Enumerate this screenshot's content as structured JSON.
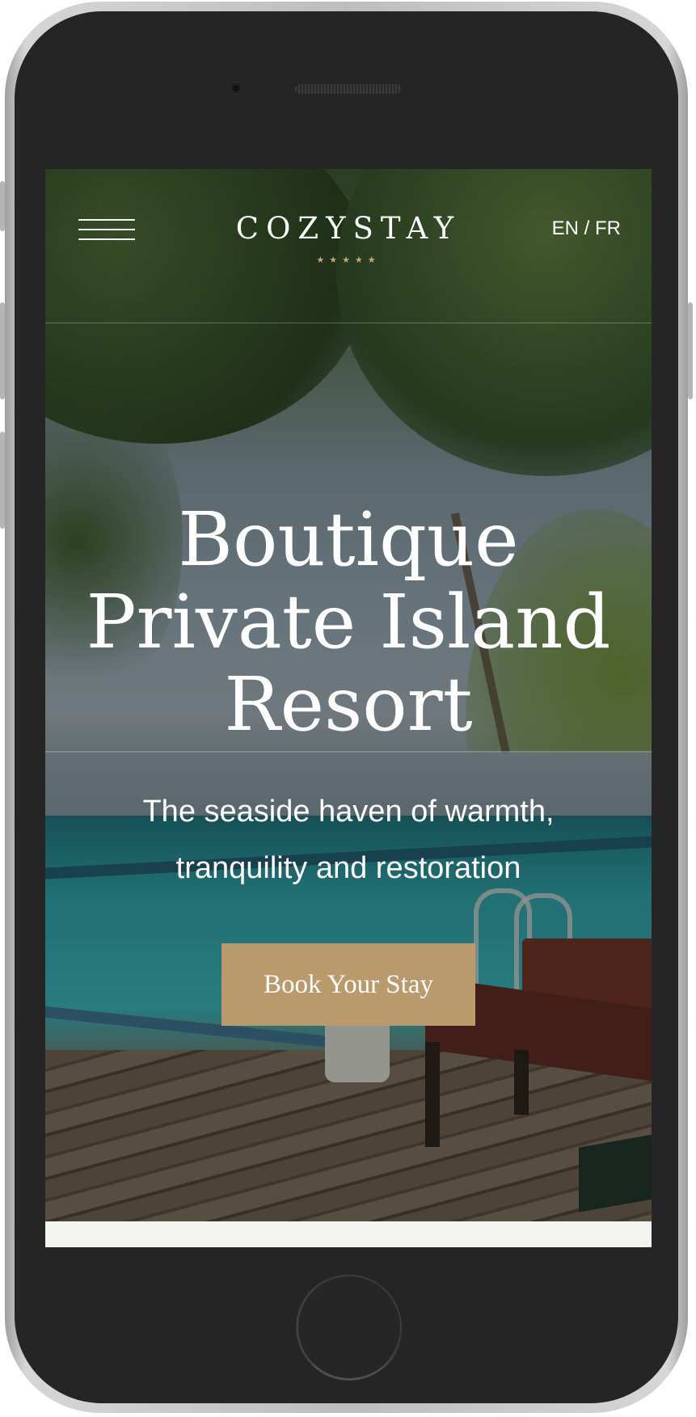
{
  "header": {
    "logo": "COZYSTAY",
    "logo_stars": "★★★★★",
    "lang_en": "EN",
    "lang_separator": "/",
    "lang_fr": "FR"
  },
  "hero": {
    "title_line1": "Boutique",
    "title_line2": "Private Island",
    "title_line3": "Resort",
    "subtitle_line1": "The seaside haven of warmth,",
    "subtitle_line2": "tranquility and restoration",
    "cta_label": "Book Your Stay"
  },
  "colors": {
    "accent": "#b99a6c",
    "star": "#c4a77d",
    "device_body": "#252525",
    "page_footer_strip": "#f3f3ef"
  },
  "icons": {
    "menu": "hamburger-icon"
  }
}
